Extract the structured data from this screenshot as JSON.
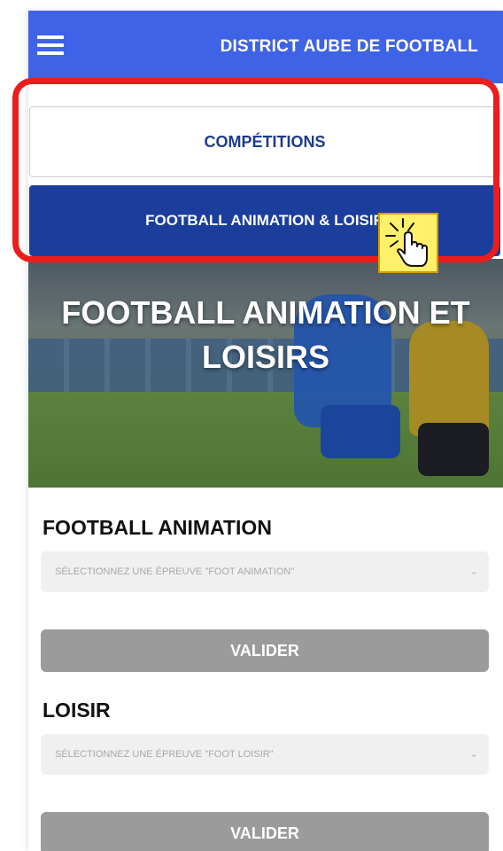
{
  "header": {
    "menu_icon": "hamburger-menu-icon",
    "title": "DISTRICT AUBE DE FOOTBALL"
  },
  "nav": {
    "competitions_label": "COMPÉTITIONS",
    "animation_loisir_label": "FOOTBALL ANIMATION & LOISIR"
  },
  "hero": {
    "title_line1": "FOOTBALL ANIMATION ET",
    "title_line2": "LOISIRS"
  },
  "cursor": {
    "icon": "hand-pointer-click-icon"
  },
  "animation_section": {
    "title": "FOOTBALL ANIMATION",
    "select_placeholder": "SÉLECTIONNEZ UNE ÉPREUVE \"FOOT ANIMATION\"",
    "submit_label": "VALIDER"
  },
  "loisir_section": {
    "title": "LOISIR",
    "select_placeholder": "SÉLECTIONNEZ UNE ÉPREUVE \"FOOT LOISIR\"",
    "submit_label": "VALIDER"
  },
  "colors": {
    "header_blue": "#3f63e6",
    "active_button_blue": "#1b3d9b",
    "highlight_red": "#ee1c1c",
    "disabled_gray": "#9b9b9b"
  }
}
